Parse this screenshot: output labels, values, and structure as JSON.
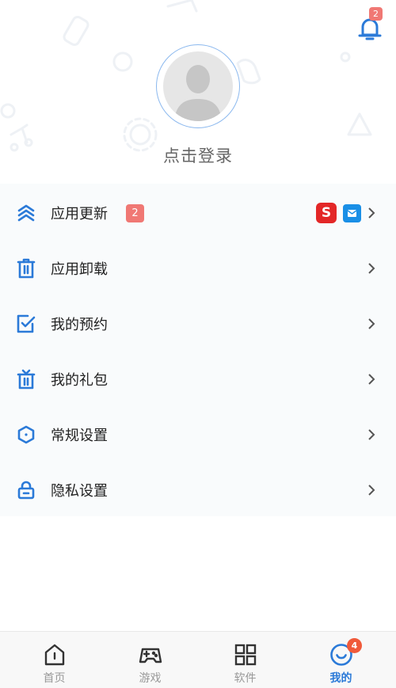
{
  "header": {
    "notification_count": "2",
    "login_text": "点击登录"
  },
  "menu": {
    "items": [
      {
        "label": "应用更新",
        "icon": "update-arrows-icon",
        "badge": "2"
      },
      {
        "label": "应用卸载",
        "icon": "trash-icon"
      },
      {
        "label": "我的预约",
        "icon": "checkbox-icon"
      },
      {
        "label": "我的礼包",
        "icon": "gift-icon"
      },
      {
        "label": "常规设置",
        "icon": "settings-shield-icon"
      },
      {
        "label": "隐私设置",
        "icon": "lock-icon"
      }
    ],
    "update_app_icons": [
      "app-icon-s",
      "app-icon-blue"
    ]
  },
  "tabbar": {
    "tabs": [
      {
        "label": "首页",
        "icon": "home-icon"
      },
      {
        "label": "游戏",
        "icon": "gamepad-icon"
      },
      {
        "label": "软件",
        "icon": "apps-grid-icon"
      },
      {
        "label": "我的",
        "icon": "smile-icon",
        "active": true,
        "badge": "4"
      }
    ]
  },
  "colors": {
    "accent": "#2b7ad8",
    "badge": "#f07874",
    "tab_badge": "#f05a3a"
  }
}
